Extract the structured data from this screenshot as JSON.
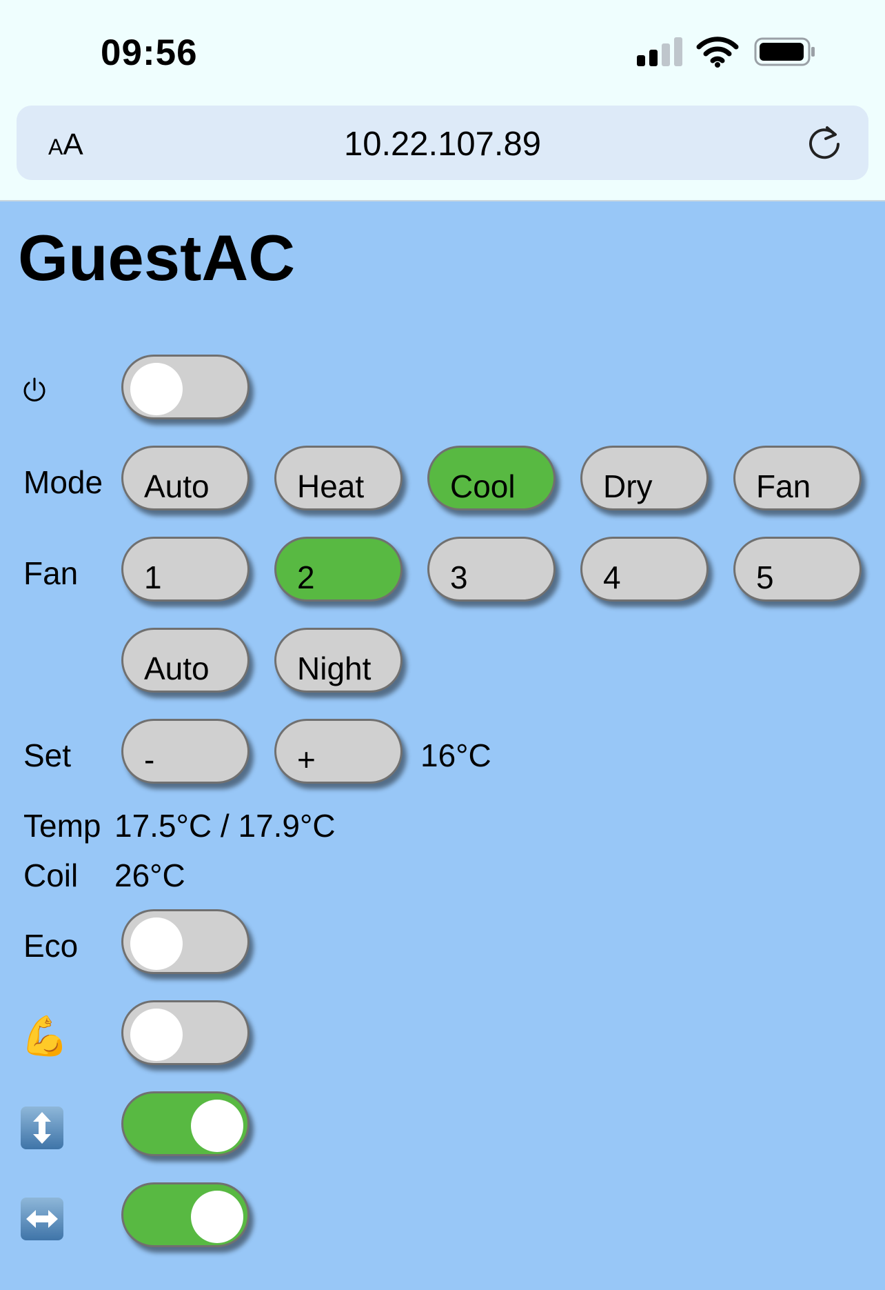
{
  "status": {
    "time": "09:56"
  },
  "browser": {
    "aa_small": "A",
    "aa_large": "A",
    "url": "10.22.107.89"
  },
  "page": {
    "title": "GuestAC"
  },
  "power": {
    "icon": "power-icon",
    "on": false
  },
  "mode": {
    "label": "Mode",
    "options": [
      "Auto",
      "Heat",
      "Cool",
      "Dry",
      "Fan"
    ],
    "selected": "Cool"
  },
  "fan": {
    "label": "Fan",
    "options": [
      "1",
      "2",
      "3",
      "4",
      "5",
      "Auto",
      "Night"
    ],
    "selected": "2"
  },
  "set": {
    "label": "Set",
    "minus": "-",
    "plus": "+",
    "value": "16°C"
  },
  "temp": {
    "label": "Temp",
    "value": "17.5°C / 17.9°C"
  },
  "coil": {
    "label": "Coil",
    "value": "26°C"
  },
  "eco": {
    "label": "Eco",
    "on": false
  },
  "turbo": {
    "icon": "flexed-biceps-icon",
    "on": false
  },
  "swing_vertical": {
    "icon": "up-down-arrow-icon",
    "on": true
  },
  "swing_horizontal": {
    "icon": "left-right-arrow-icon",
    "on": true
  },
  "colors": {
    "background": "#98c7f7",
    "active": "#58b942",
    "inactive": "#d0d0d0"
  }
}
